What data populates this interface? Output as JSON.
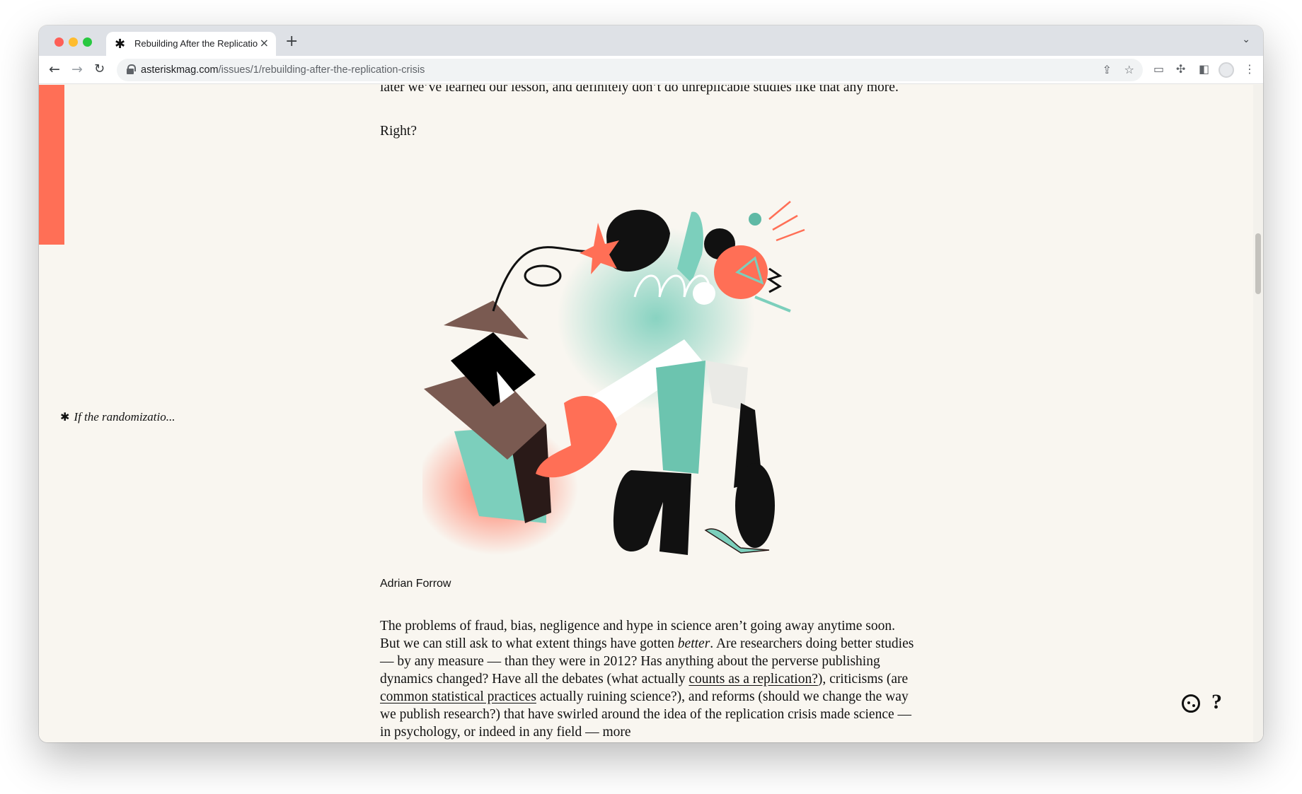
{
  "browser": {
    "tab_title": "Rebuilding After the Replicatio",
    "tab_favicon": "✱",
    "url_domain": "asteriskmag.com",
    "url_path": "/issues/1/rebuilding-after-the-replication-crisis"
  },
  "article": {
    "top_paragraph": "later we’ve learned our lesson, and definitely don’t do unreplicable studies like that any more.",
    "right_question": "Right?",
    "illustration_credit": "Adrian Forrow",
    "main_paragraph": {
      "part1": "The problems of fraud, bias, negligence and hype in science aren’t going away anytime soon. But we can still ask to what extent things have gotten ",
      "emphasis": "better",
      "part2": ". Are researchers doing better studies — by any measure — than they were in 2012? Has anything about the perverse publishing dynamics changed? Have all the debates (what actually ",
      "link1": "counts as a replication?",
      "part3": "), criticisms (are ",
      "link2": "common statistical practices",
      "part4": " actually ruining science?), and reforms (should we change the way we publish research?) that have swirled around the idea of the replication crisis made science — in psychology, or indeed in any field — more"
    }
  },
  "sidebar": {
    "footnote_star": "✱",
    "footnote_text": "If the randomizatio..."
  },
  "controls": {
    "help_label": "?"
  },
  "colors": {
    "accent": "#ff6f56",
    "teal": "#7ccfbc",
    "brown": "#7a5a51",
    "page_bg": "#f9f6f0"
  }
}
